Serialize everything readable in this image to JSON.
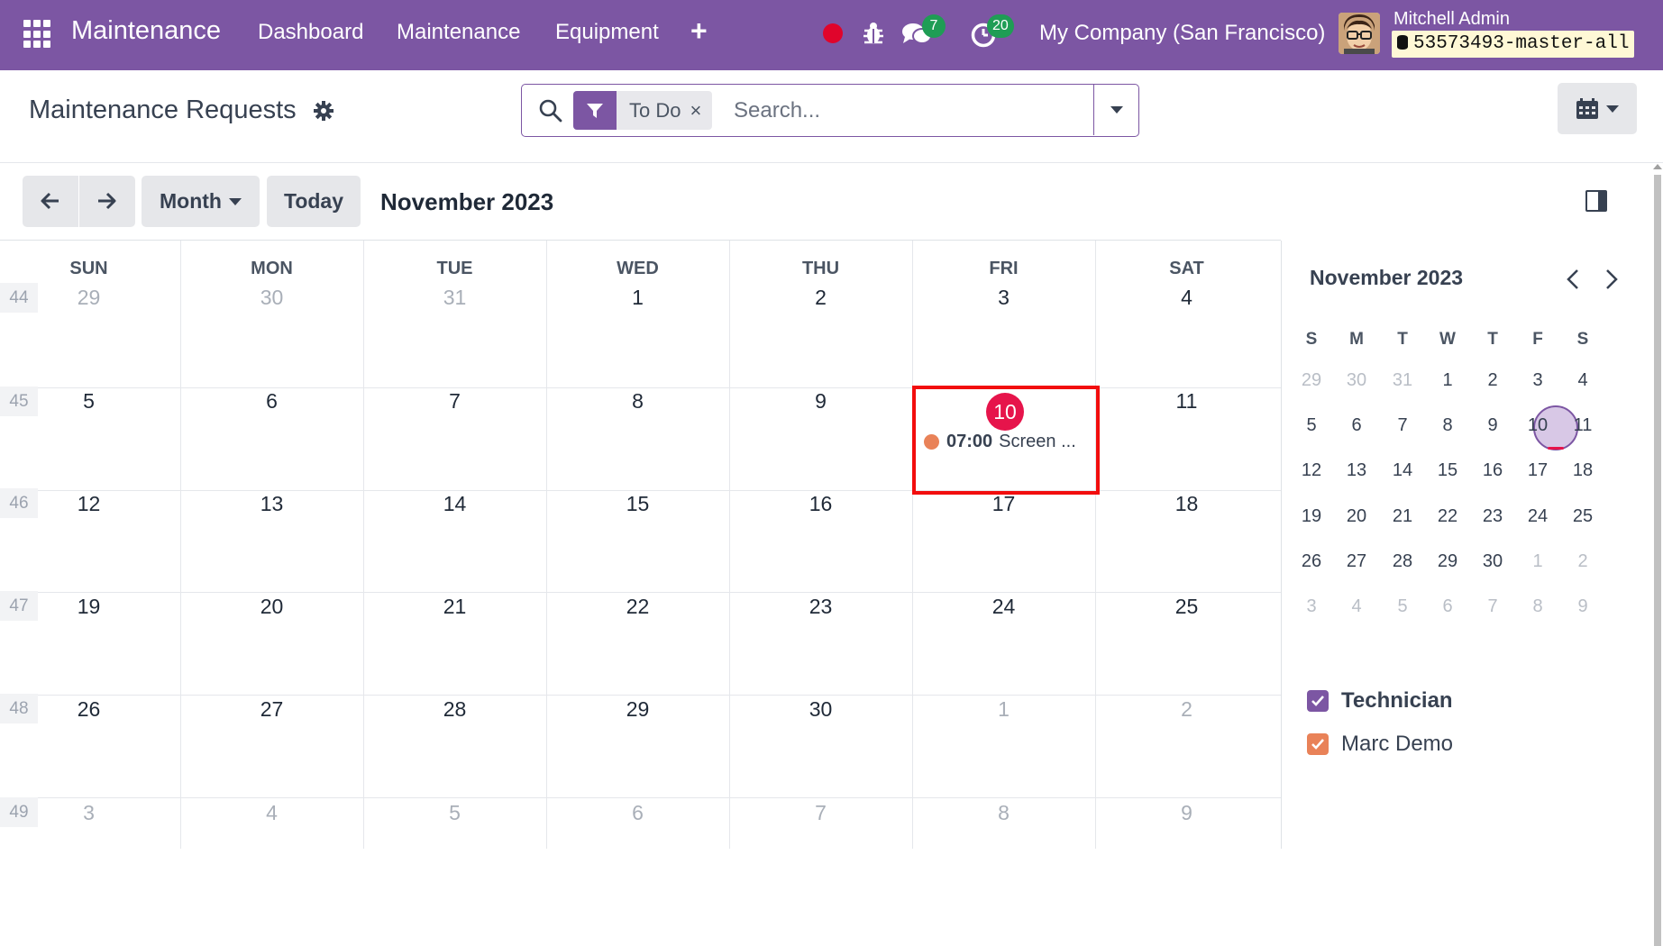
{
  "navbar": {
    "brand": "Maintenance",
    "menu": [
      "Dashboard",
      "Maintenance",
      "Equipment"
    ],
    "messages_count": "7",
    "activities_count": "20",
    "company": "My Company (San Francisco)",
    "user": "Mitchell Admin",
    "database": "53573493-master-all",
    "color": "#7c56a3"
  },
  "control": {
    "title": "Maintenance Requests",
    "facet_label": "To Do",
    "facet_close": "×",
    "search_placeholder": "Search..."
  },
  "toolbar": {
    "scale_label": "Month",
    "today_label": "Today",
    "period_title": "November 2023"
  },
  "calendar": {
    "weekdays": [
      "SUN",
      "MON",
      "TUE",
      "WED",
      "THU",
      "FRI",
      "SAT"
    ],
    "weeks": [
      {
        "num": "44",
        "days": [
          "29",
          "30",
          "31",
          "1",
          "2",
          "3",
          "4"
        ],
        "muted": [
          true,
          true,
          true,
          false,
          false,
          false,
          false
        ]
      },
      {
        "num": "45",
        "days": [
          "5",
          "6",
          "7",
          "8",
          "9",
          "10",
          "11"
        ],
        "muted": [
          false,
          false,
          false,
          false,
          false,
          false,
          false
        ]
      },
      {
        "num": "46",
        "days": [
          "12",
          "13",
          "14",
          "15",
          "16",
          "17",
          "18"
        ],
        "muted": [
          false,
          false,
          false,
          false,
          false,
          false,
          false
        ]
      },
      {
        "num": "47",
        "days": [
          "19",
          "20",
          "21",
          "22",
          "23",
          "24",
          "25"
        ],
        "muted": [
          false,
          false,
          false,
          false,
          false,
          false,
          false
        ]
      },
      {
        "num": "48",
        "days": [
          "26",
          "27",
          "28",
          "29",
          "30",
          "1",
          "2"
        ],
        "muted": [
          false,
          false,
          false,
          false,
          false,
          true,
          true
        ]
      },
      {
        "num": "49",
        "days": [
          "3",
          "4",
          "5",
          "6",
          "7",
          "8",
          "9"
        ],
        "muted": [
          true,
          true,
          true,
          true,
          true,
          true,
          true
        ]
      }
    ],
    "today": "10",
    "event": {
      "time": "07:00",
      "title": "Screen ...",
      "color": "#e98258"
    },
    "today_color": "#e6144b"
  },
  "mini_calendar": {
    "title": "November 2023",
    "weekdays": [
      "S",
      "M",
      "T",
      "W",
      "T",
      "F",
      "S"
    ],
    "weeks": [
      {
        "days": [
          "29",
          "30",
          "31",
          "1",
          "2",
          "3",
          "4"
        ],
        "muted": [
          true,
          true,
          true,
          false,
          false,
          false,
          false
        ]
      },
      {
        "days": [
          "5",
          "6",
          "7",
          "8",
          "9",
          "10",
          "11"
        ],
        "muted": [
          false,
          false,
          false,
          false,
          false,
          false,
          false
        ]
      },
      {
        "days": [
          "12",
          "13",
          "14",
          "15",
          "16",
          "17",
          "18"
        ],
        "muted": [
          false,
          false,
          false,
          false,
          false,
          false,
          false
        ]
      },
      {
        "days": [
          "19",
          "20",
          "21",
          "22",
          "23",
          "24",
          "25"
        ],
        "muted": [
          false,
          false,
          false,
          false,
          false,
          false,
          false
        ]
      },
      {
        "days": [
          "26",
          "27",
          "28",
          "29",
          "30",
          "1",
          "2"
        ],
        "muted": [
          false,
          false,
          false,
          false,
          false,
          true,
          true
        ]
      },
      {
        "days": [
          "3",
          "4",
          "5",
          "6",
          "7",
          "8",
          "9"
        ],
        "muted": [
          true,
          true,
          true,
          true,
          true,
          true,
          true
        ]
      }
    ]
  },
  "filters": {
    "group_label": "Technician",
    "group_color": "#7c56a3",
    "items": [
      {
        "label": "Marc Demo",
        "color": "#e98258",
        "checked": true
      }
    ]
  }
}
